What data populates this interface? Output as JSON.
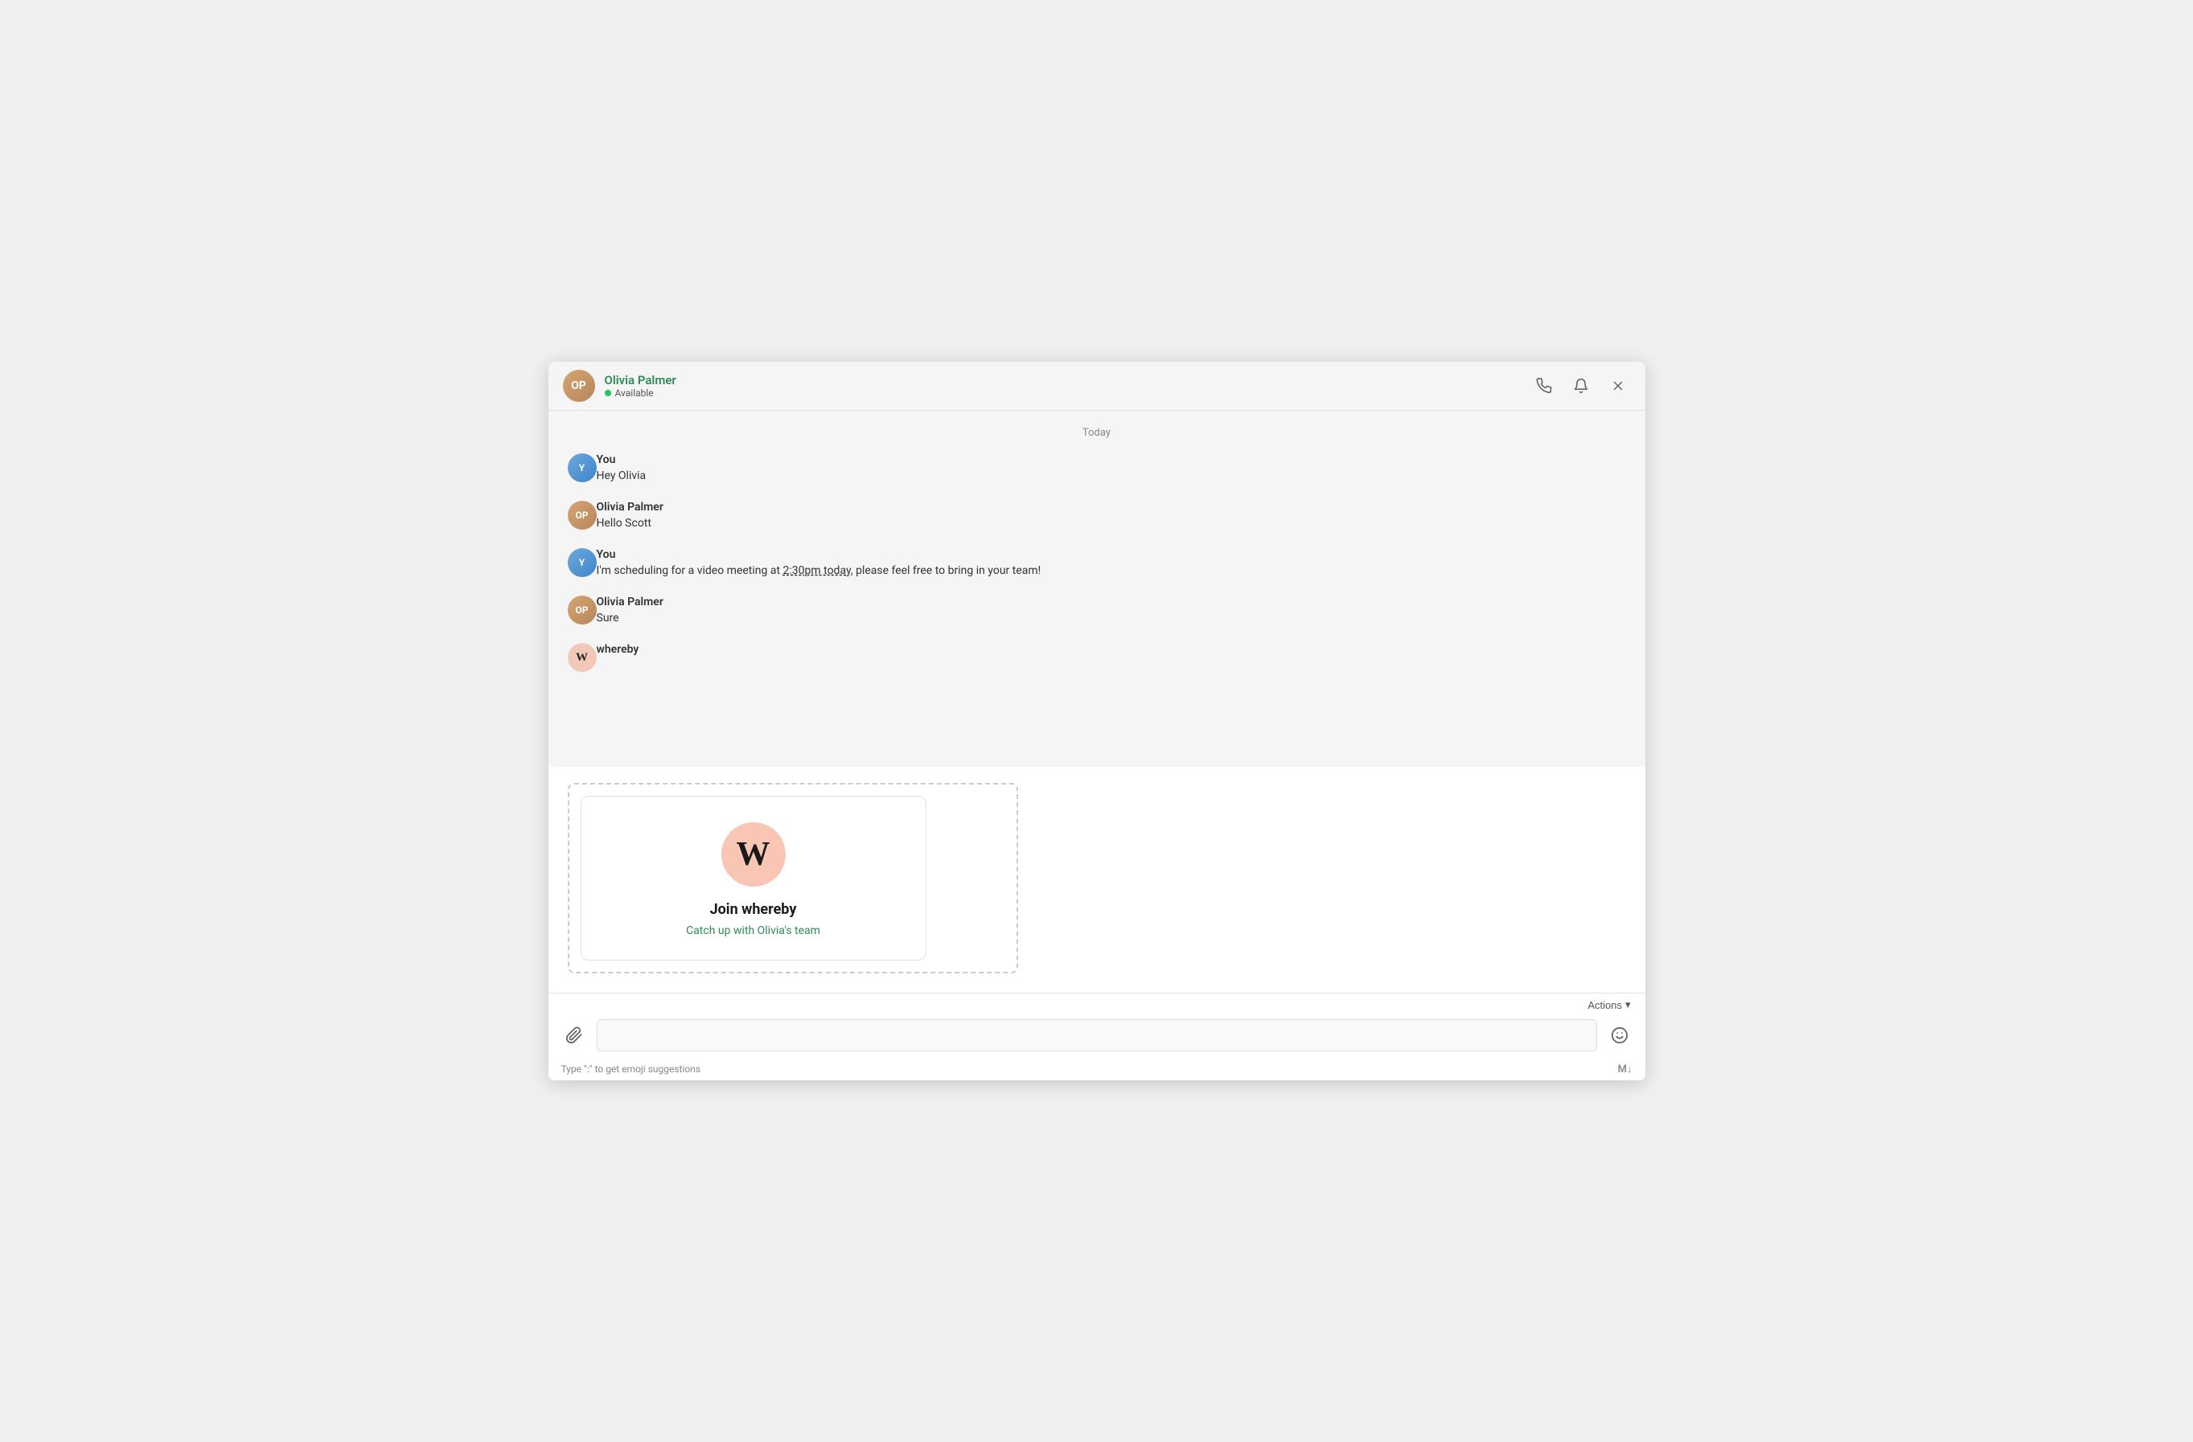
{
  "header": {
    "contact_name": "Olivia Palmer",
    "status": "Available",
    "status_color": "#22c55e",
    "phone_icon": "📞",
    "bell_icon": "🔔",
    "close_icon": "✕"
  },
  "chat": {
    "date_separator": "Today",
    "messages": [
      {
        "sender": "You",
        "avatar_initials": "Y",
        "avatar_type": "you",
        "text": "Hey Olivia"
      },
      {
        "sender": "Olivia Palmer",
        "avatar_initials": "OP",
        "avatar_type": "olivia",
        "text": "Hello Scott"
      },
      {
        "sender": "You",
        "avatar_initials": "Y",
        "avatar_type": "you",
        "text_parts": [
          {
            "type": "plain",
            "content": "I'm scheduling for a video meeting at "
          },
          {
            "type": "underline",
            "content": "2:30pm today"
          },
          {
            "type": "plain",
            "content": ", please feel free to bring in your team!"
          }
        ]
      },
      {
        "sender": "Olivia Palmer",
        "avatar_initials": "OP",
        "avatar_type": "olivia",
        "text": "Sure"
      },
      {
        "sender": "whereby",
        "avatar_initials": "W",
        "avatar_type": "whereby"
      }
    ]
  },
  "whereby_card": {
    "logo_letter": "W",
    "title": "Join whereby",
    "link_text": "Catch up with Olivia's team"
  },
  "bottom_bar": {
    "actions_label": "Actions",
    "chevron_icon": "▾",
    "attach_icon": "📎",
    "emoji_icon": "🙂",
    "emoji_hint": "Type \":\" to get emoji suggestions",
    "markdown_icon": "M↓",
    "input_placeholder": ""
  }
}
